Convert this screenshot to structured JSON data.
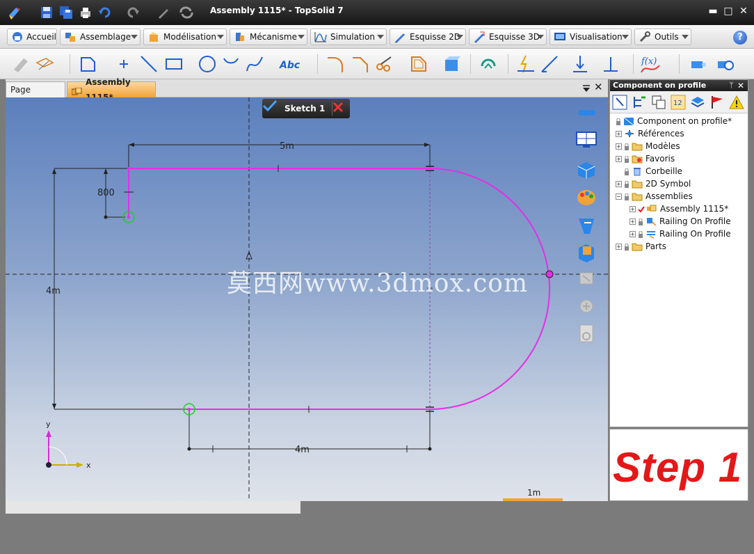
{
  "window": {
    "title": "Assembly 1115* - TopSolid 7",
    "minimize": "▬",
    "maximize": "□",
    "close": "✕"
  },
  "ribbon_tabs": [
    {
      "label": "Accueil",
      "icon": "home-icon"
    },
    {
      "label": "Assemblage",
      "icon": "assembly-icon"
    },
    {
      "label": "Modélisation",
      "icon": "modeling-icon"
    },
    {
      "label": "Mécanisme",
      "icon": "mechanism-icon"
    },
    {
      "label": "Simulation",
      "icon": "simulation-icon"
    },
    {
      "label": "Esquisse 2D",
      "icon": "sketch-2d-icon"
    },
    {
      "label": "Esquisse 3D",
      "icon": "sketch-3d-icon"
    },
    {
      "label": "Visualisation",
      "icon": "visualisation-icon"
    },
    {
      "label": "Outils",
      "icon": "tools-icon"
    }
  ],
  "help_label": "?",
  "doc_tabs": {
    "home": "Page d'accueil",
    "assembly": "Assembly 1115*"
  },
  "sketch": {
    "name": "Sketch 1",
    "dims": {
      "top_width": "5m",
      "offset_height": "800",
      "total_height": "4m",
      "bottom_width": "4m"
    },
    "axes": {
      "x": "x",
      "y": "y"
    },
    "scale_bar": "1m"
  },
  "watermark": "莫西网www.3dmox.com",
  "panel": {
    "title": "Component on profile",
    "pin": "ᛘ",
    "close": "✕",
    "tree": [
      {
        "label": "Component on profile*",
        "level": 0
      },
      {
        "label": "Références",
        "level": 1
      },
      {
        "label": "Modèles",
        "level": 1
      },
      {
        "label": "Favoris",
        "level": 1
      },
      {
        "label": "Corbeille",
        "level": 1
      },
      {
        "label": "2D Symbol",
        "level": 1
      },
      {
        "label": "Assemblies",
        "level": 1
      },
      {
        "label": "Assembly 1115*",
        "level": 2
      },
      {
        "label": "Railing On Profile",
        "level": 2
      },
      {
        "label": "Railing On Profile",
        "level": 2
      },
      {
        "label": "Parts",
        "level": 1
      }
    ]
  },
  "step_label": "Step 1",
  "colors": {
    "profile": "#e62ee6",
    "accent_orange": "#f0a33a",
    "step_red": "#e31818",
    "constraint_green": "#22cc22"
  }
}
